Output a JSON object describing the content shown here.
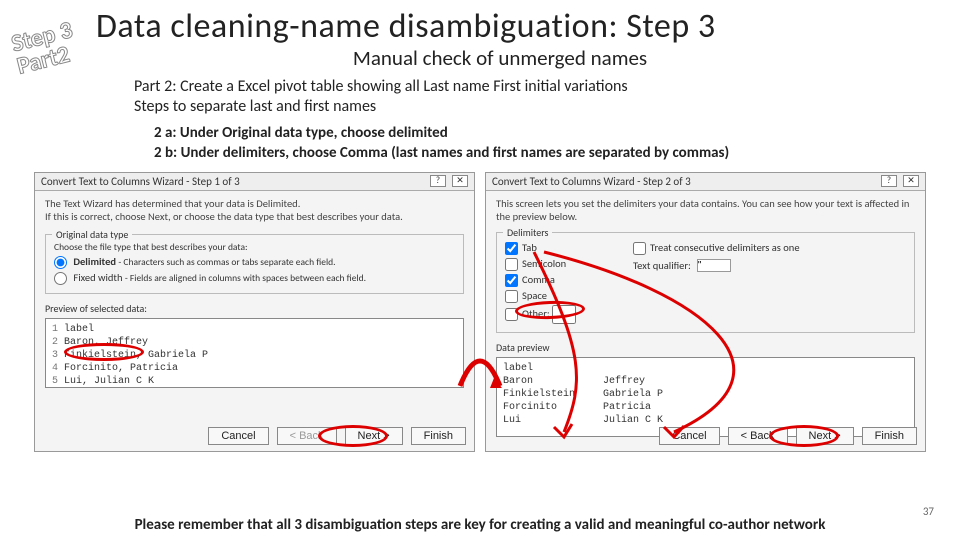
{
  "stamp": {
    "line1": "Step 3",
    "line2": "Part2"
  },
  "title": "Data cleaning-name disambiguation: Step 3",
  "subtitle": "Manual check of unmerged names",
  "intro": {
    "line1": "Part 2: Create a Excel pivot table showing all Last name First initial variations",
    "line2": "Steps to separate last and first names"
  },
  "bullets": {
    "a": "2 a: Under Original data type, choose delimited",
    "b": "2 b: Under delimiters, choose Comma (last names and first names are separated by commas)"
  },
  "wiz1": {
    "title": "Convert Text to Columns Wizard - Step 1 of 3",
    "help_icon": "?",
    "close_icon": "✕",
    "line1": "The Text Wizard has determined that your data is Delimited.",
    "line2": "If this is correct, choose Next, or choose the data type that best describes your data.",
    "group_legend": "Original data type",
    "group_prompt": "Choose the file type that best describes your data:",
    "opt_delimited": "Delimited",
    "opt_delimited_desc": "- Characters such as commas or tabs separate each field.",
    "opt_fixed": "Fixed width",
    "opt_fixed_desc": "- Fields are aligned in columns with spaces between each field.",
    "preview_label": "Preview of selected data:",
    "rows": [
      "label",
      "Baron, Jeffrey",
      "Finkielstein, Gabriela P",
      "Forcinito, Patricia",
      "Lui, Julian C K"
    ],
    "buttons": {
      "cancel": "Cancel",
      "back": "< Back",
      "next": "Next >",
      "finish": "Finish"
    }
  },
  "wiz2": {
    "title": "Convert Text to Columns Wizard - Step 2 of 3",
    "help_icon": "?",
    "close_icon": "✕",
    "line1": "This screen lets you set the delimiters your data contains. You can see how your text is affected in the preview below.",
    "group_legend": "Delimiters",
    "opt_tab": "Tab",
    "opt_semi": "Semicolon",
    "opt_comma": "Comma",
    "opt_space": "Space",
    "opt_other": "Other:",
    "treat": "Treat consecutive delimiters as one",
    "qualifier_label": "Text qualifier:",
    "qualifier_value": "\"",
    "preview_label": "Data preview",
    "rows": [
      {
        "c1": "label",
        "c2": ""
      },
      {
        "c1": "Baron",
        "c2": "Jeffrey"
      },
      {
        "c1": "Finkielstein",
        "c2": "Gabriela P"
      },
      {
        "c1": "Forcinito",
        "c2": "Patricia"
      },
      {
        "c1": "Lui",
        "c2": "Julian C K"
      }
    ],
    "buttons": {
      "cancel": "Cancel",
      "back": "< Back",
      "next": "Next >",
      "finish": "Finish"
    }
  },
  "footer": "Please remember that all 3 disambiguation steps are key for creating a valid and meaningful co-author network",
  "page_number": "37"
}
